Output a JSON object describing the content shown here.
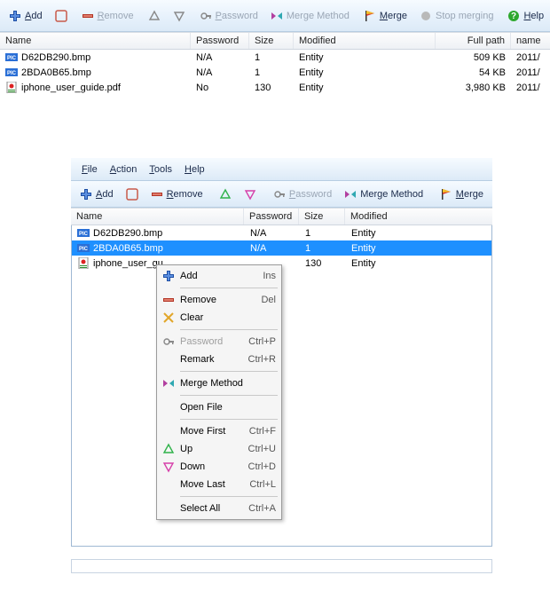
{
  "top": {
    "toolbar": {
      "add": "Add",
      "remove": "Remove",
      "password": "Password",
      "merge_method": "Merge Method",
      "merge": "Merge",
      "stop": "Stop merging",
      "help": "Help"
    },
    "columns": {
      "name": "Name",
      "password": "Password",
      "size": "Size",
      "modified": "Modified",
      "fullpath": "Full path",
      "name2": "name"
    },
    "rows": [
      {
        "name": "D62DB290.bmp",
        "type": "bmp",
        "password": "N/A",
        "size": "1",
        "modified": "Entity",
        "fullpath": "509 KB",
        "name2": "2011/"
      },
      {
        "name": "2BDA0B65.bmp",
        "type": "bmp",
        "password": "N/A",
        "size": "1",
        "modified": "Entity",
        "fullpath": "54 KB",
        "name2": "2011/"
      },
      {
        "name": "iphone_user_guide.pdf",
        "type": "pdf",
        "password": "No",
        "size": "130",
        "modified": "Entity",
        "fullpath": "3,980 KB",
        "name2": "2011/"
      }
    ]
  },
  "win2": {
    "menu": {
      "file": "File",
      "action": "Action",
      "tools": "Tools",
      "help": "Help"
    },
    "toolbar": {
      "add": "Add",
      "remove": "Remove",
      "password": "Password",
      "merge_method": "Merge Method",
      "merge": "Merge"
    },
    "columns": {
      "name": "Name",
      "password": "Password",
      "size": "Size",
      "modified": "Modified"
    },
    "rows": [
      {
        "name": "D62DB290.bmp",
        "type": "bmp",
        "password": "N/A",
        "size": "1",
        "modified": "Entity",
        "selected": false
      },
      {
        "name": "2BDA0B65.bmp",
        "type": "bmp",
        "password": "N/A",
        "size": "1",
        "modified": "Entity",
        "selected": true
      },
      {
        "name": "iphone_user_gu",
        "type": "pdf",
        "password": "",
        "size": "130",
        "modified": "Entity",
        "selected": false
      }
    ]
  },
  "ctx": {
    "add": {
      "label": "Add",
      "sc": "Ins"
    },
    "remove": {
      "label": "Remove",
      "sc": "Del"
    },
    "clear": {
      "label": "Clear",
      "sc": ""
    },
    "password": {
      "label": "Password",
      "sc": "Ctrl+P"
    },
    "remark": {
      "label": "Remark",
      "sc": "Ctrl+R"
    },
    "mergemethod": {
      "label": "Merge Method",
      "sc": ""
    },
    "openfile": {
      "label": "Open File",
      "sc": ""
    },
    "movefirst": {
      "label": "Move First",
      "sc": "Ctrl+F"
    },
    "up": {
      "label": "Up",
      "sc": "Ctrl+U"
    },
    "down": {
      "label": "Down",
      "sc": "Ctrl+D"
    },
    "movelast": {
      "label": "Move Last",
      "sc": "Ctrl+L"
    },
    "selectall": {
      "label": "Select All",
      "sc": "Ctrl+A"
    }
  }
}
